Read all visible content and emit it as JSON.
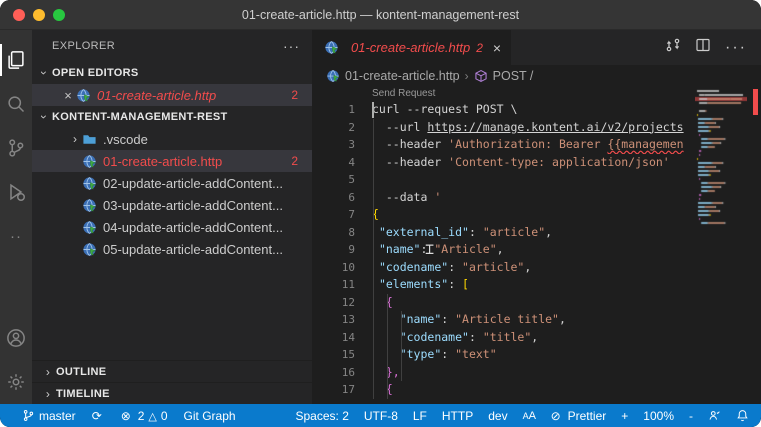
{
  "window": {
    "title": "01-create-article.http — kontent-management-rest"
  },
  "activity_bar": {
    "items": [
      {
        "name": "explorer",
        "active": true
      },
      {
        "name": "search",
        "active": false
      },
      {
        "name": "source-control",
        "active": false
      },
      {
        "name": "run-debug",
        "active": false
      },
      {
        "name": "more-views",
        "active": false
      }
    ],
    "bottom_items": [
      {
        "name": "accounts"
      },
      {
        "name": "settings"
      }
    ]
  },
  "sidebar": {
    "title": "EXPLORER",
    "more_label": "···",
    "open_editors_label": "OPEN EDITORS",
    "open_editor": {
      "label": "01-create-article.http",
      "badge": "2",
      "close": "×"
    },
    "workspace_label": "KONTENT-MANAGEMENT-REST",
    "tree": [
      {
        "label": ".vscode",
        "type": "folder",
        "chevron": "›"
      },
      {
        "label": "01-create-article.http",
        "type": "http",
        "badge": "2",
        "error": true,
        "selected": true
      },
      {
        "label": "02-update-article-addContent...",
        "type": "http"
      },
      {
        "label": "03-update-article-addContent...",
        "type": "http"
      },
      {
        "label": "04-update-article-addContent...",
        "type": "http"
      },
      {
        "label": "05-update-article-addContent...",
        "type": "http"
      }
    ],
    "outline_label": "OUTLINE",
    "timeline_label": "TIMELINE"
  },
  "editor": {
    "tab": {
      "label": "01-create-article.http",
      "badge": "2",
      "close": "×"
    },
    "breadcrumb": {
      "file": "01-create-article.http",
      "separator": "›",
      "symbol": "POST /"
    },
    "codelens": "Send Request",
    "code_lines": [
      {
        "n": "1",
        "segs": [
          {
            "t": "curl --request POST \\",
            "c": "fg"
          }
        ]
      },
      {
        "n": "2",
        "segs": [
          {
            "t": "  --url ",
            "c": "fg"
          },
          {
            "t": "https://manage.kontent.ai/v2/projects",
            "c": "url"
          }
        ]
      },
      {
        "n": "3",
        "segs": [
          {
            "t": "  --header ",
            "c": "fg"
          },
          {
            "t": "'Authorization: Bearer ",
            "c": "str"
          },
          {
            "t": "{{managemen",
            "c": "sq"
          }
        ]
      },
      {
        "n": "4",
        "segs": [
          {
            "t": "  --header ",
            "c": "fg"
          },
          {
            "t": "'Content-type: application/json'",
            "c": "str"
          }
        ]
      },
      {
        "n": "5",
        "segs": []
      },
      {
        "n": "6",
        "segs": [
          {
            "t": "  --data ",
            "c": "fg"
          },
          {
            "t": "'",
            "c": "str"
          }
        ]
      },
      {
        "n": "7",
        "segs": [
          {
            "t": "{",
            "c": "b1"
          }
        ]
      },
      {
        "n": "8",
        "segs": [
          {
            "t": " ",
            "c": "fg"
          },
          {
            "t": "\"external_id\"",
            "c": "key"
          },
          {
            "t": ": ",
            "c": "fg"
          },
          {
            "t": "\"article\"",
            "c": "str"
          },
          {
            "t": ",",
            "c": "fg"
          }
        ]
      },
      {
        "n": "9",
        "segs": [
          {
            "t": " ",
            "c": "fg"
          },
          {
            "t": "\"name\"",
            "c": "key"
          },
          {
            "t": ": ",
            "c": "fg"
          },
          {
            "t": "\"Article\"",
            "c": "str"
          },
          {
            "t": ",",
            "c": "fg"
          }
        ]
      },
      {
        "n": "10",
        "segs": [
          {
            "t": " ",
            "c": "fg"
          },
          {
            "t": "\"codename\"",
            "c": "key"
          },
          {
            "t": ": ",
            "c": "fg"
          },
          {
            "t": "\"article\"",
            "c": "str"
          },
          {
            "t": ",",
            "c": "fg"
          }
        ]
      },
      {
        "n": "11",
        "segs": [
          {
            "t": " ",
            "c": "fg"
          },
          {
            "t": "\"elements\"",
            "c": "key"
          },
          {
            "t": ": ",
            "c": "fg"
          },
          {
            "t": "[",
            "c": "b1"
          }
        ]
      },
      {
        "n": "12",
        "segs": [
          {
            "t": "  ",
            "c": "fg"
          },
          {
            "t": "{",
            "c": "b2"
          }
        ]
      },
      {
        "n": "13",
        "segs": [
          {
            "t": "    ",
            "c": "fg"
          },
          {
            "t": "\"name\"",
            "c": "key"
          },
          {
            "t": ": ",
            "c": "fg"
          },
          {
            "t": "\"Article title\"",
            "c": "str"
          },
          {
            "t": ",",
            "c": "fg"
          }
        ]
      },
      {
        "n": "14",
        "segs": [
          {
            "t": "    ",
            "c": "fg"
          },
          {
            "t": "\"codename\"",
            "c": "key"
          },
          {
            "t": ": ",
            "c": "fg"
          },
          {
            "t": "\"title\"",
            "c": "str"
          },
          {
            "t": ",",
            "c": "fg"
          }
        ]
      },
      {
        "n": "15",
        "segs": [
          {
            "t": "    ",
            "c": "fg"
          },
          {
            "t": "\"type\"",
            "c": "key"
          },
          {
            "t": ": ",
            "c": "fg"
          },
          {
            "t": "\"text\"",
            "c": "str"
          }
        ]
      },
      {
        "n": "16",
        "segs": [
          {
            "t": "  ",
            "c": "fg"
          },
          {
            "t": "},",
            "c": "b2"
          }
        ]
      },
      {
        "n": "17",
        "segs": [
          {
            "t": "  ",
            "c": "fg"
          },
          {
            "t": "{",
            "c": "b2"
          }
        ]
      }
    ]
  },
  "status_bar": {
    "left": [
      {
        "icon": "branch",
        "label": "master"
      },
      {
        "icon": "sync",
        "label": ""
      },
      {
        "icon": "error",
        "label": "2",
        "icon2": "warning",
        "label2": "0"
      },
      {
        "label": "Git Graph"
      },
      {
        "label": "Spaces: 2"
      },
      {
        "label": "UTF-8"
      },
      {
        "label": "LF"
      },
      {
        "label": "HTTP"
      },
      {
        "label": "dev"
      },
      {
        "icon": "font-size",
        "label": ""
      },
      {
        "icon": "prettier",
        "label": "Prettier"
      },
      {
        "label": "+"
      },
      {
        "label": "100%"
      },
      {
        "label": "-"
      },
      {
        "icon": "feedback",
        "label": ""
      },
      {
        "icon": "bell",
        "label": ""
      }
    ],
    "left_count": 4
  },
  "colors": {
    "status_bar": "#0a7acc",
    "error_red": "#f14c4c",
    "key_blue": "#9cdcfe",
    "string_orange": "#ce9178",
    "bracket_gold": "#ffd700",
    "bracket_pink": "#da70d6",
    "editor_bg": "#1e1e1e",
    "sidebar_bg": "#252526"
  }
}
